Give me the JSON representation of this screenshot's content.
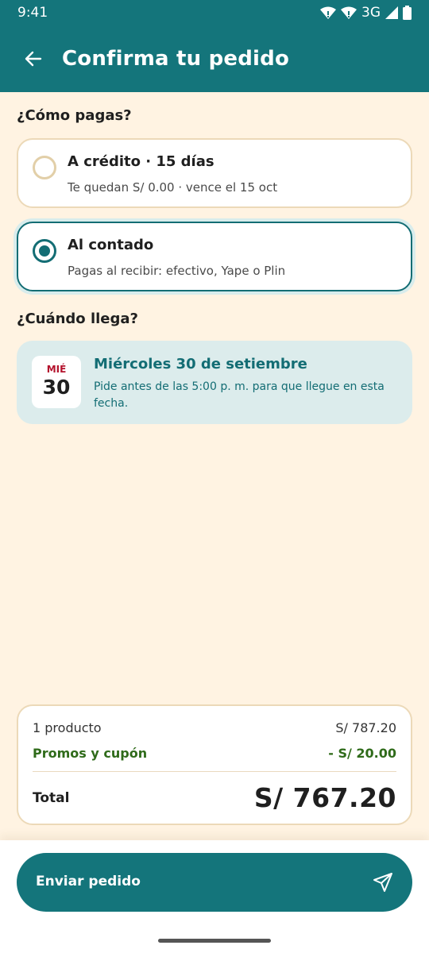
{
  "status_bar": {
    "time": "9:41",
    "network": "3G"
  },
  "header": {
    "title": "Confirma tu pedido"
  },
  "payment": {
    "section_title": "¿Cómo pagas?",
    "options": [
      {
        "title": "A crédito · 15 días",
        "subtitle": "Te quedan S/ 0.00 · vence el 15 oct",
        "selected": false
      },
      {
        "title": "Al contado",
        "subtitle": "Pagas al recibir: efectivo, Yape o Plin",
        "selected": true
      }
    ]
  },
  "delivery": {
    "section_title": "¿Cuándo llega?",
    "day_of_week": "MIÉ",
    "day": "30",
    "title": "Miércoles 30 de setiembre",
    "subtitle": "Pide antes de las 5:00 p. m. para que llegue en esta fecha."
  },
  "summary": {
    "products_label": "1 producto",
    "products_value": "S/ 787.20",
    "promo_label": "Promos y cupón",
    "promo_value": "- S/ 20.00",
    "total_label": "Total",
    "total_value": "S/ 767.20"
  },
  "actions": {
    "send_label": "Enviar pedido"
  },
  "colors": {
    "primary": "#14757b",
    "background": "#fff3e2",
    "accent_red": "#b4122c",
    "promo_green": "#2f6b1a"
  }
}
